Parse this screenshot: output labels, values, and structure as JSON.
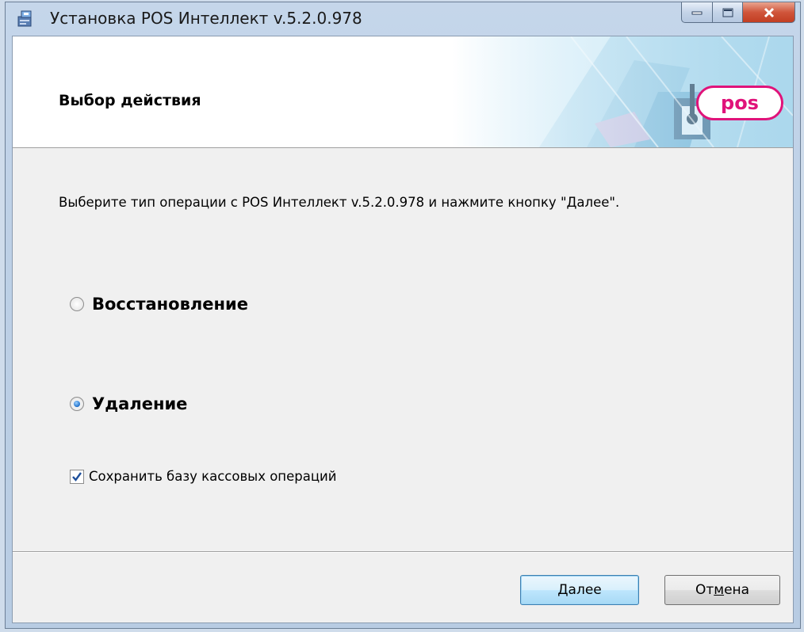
{
  "window": {
    "title": "Установка POS Интеллект v.5.2.0.978",
    "icon": "installer-icon"
  },
  "banner": {
    "title": "Выбор действия",
    "logo_text": "pos",
    "logo_color": "#e0137a"
  },
  "body": {
    "instruction": "Выберите тип операции с POS Интеллект v.5.2.0.978 и нажмите кнопку \"Далее\".",
    "options": [
      {
        "label": "Восстановление",
        "selected": false
      },
      {
        "label": "Удаление",
        "selected": true
      }
    ],
    "checkbox": {
      "label": "Сохранить базу кассовых операций",
      "checked": true
    }
  },
  "buttons": {
    "next_label": "Далее",
    "cancel_prefix": "От",
    "cancel_underlined": "м",
    "cancel_suffix": "ена"
  }
}
